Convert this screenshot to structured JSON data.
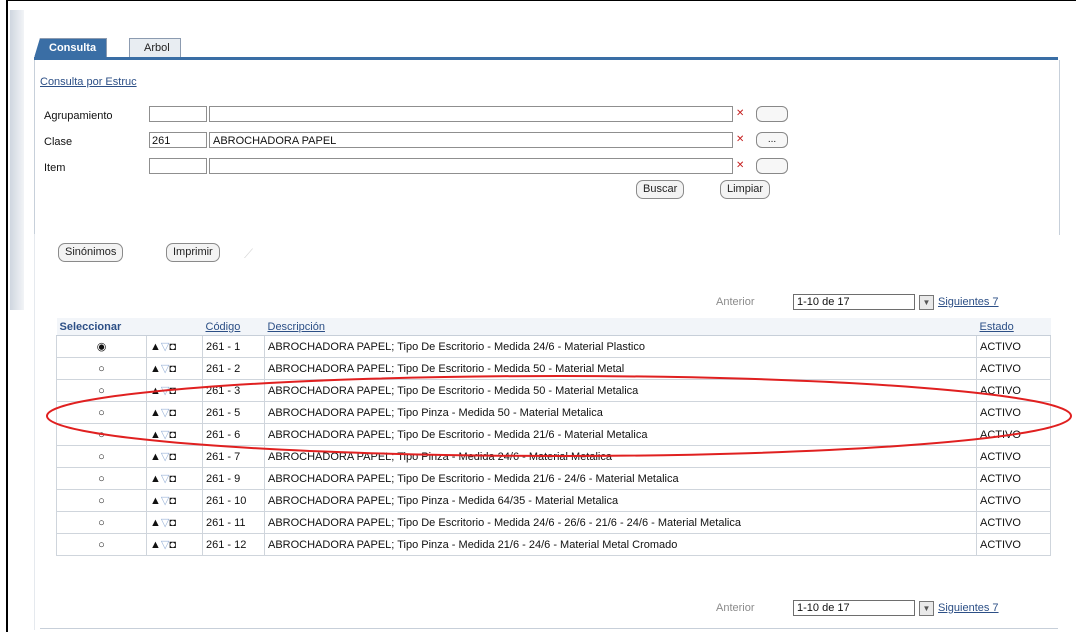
{
  "tabs": [
    {
      "label": "Consulta"
    },
    {
      "label": "Arbol"
    }
  ],
  "section_link": "Consulta por Estruc",
  "fields": [
    {
      "label": "Agrupamiento",
      "code": "",
      "desc": ""
    },
    {
      "label": "Clase",
      "code": "261",
      "desc": "ABROCHADORA PAPEL"
    },
    {
      "label": "Item",
      "code": "",
      "desc": ""
    }
  ],
  "lov_label": "...",
  "buttons": {
    "buscar": "Buscar",
    "limpiar": "Limpiar",
    "sinonimos": "Sinónimos",
    "imprimir": "Imprimir"
  },
  "pager": {
    "prev": "Anterior",
    "range": "1-10 de 17",
    "next": "Siguientes 7"
  },
  "table": {
    "headers": {
      "select": "Seleccionar",
      "code": "Código",
      "desc": "Descripción",
      "state": "Estado"
    },
    "rows": [
      {
        "selected": true,
        "code": "261 - 1",
        "desc": "ABROCHADORA PAPEL; Tipo De Escritorio - Medida 24/6 - Material Plastico",
        "state": "ACTIVO"
      },
      {
        "selected": false,
        "code": "261 - 2",
        "desc": "ABROCHADORA PAPEL; Tipo De Escritorio - Medida 50 - Material Metal",
        "state": "ACTIVO"
      },
      {
        "selected": false,
        "code": "261 - 3",
        "desc": "ABROCHADORA PAPEL; Tipo De Escritorio - Medida 50 - Material Metalica",
        "state": "ACTIVO"
      },
      {
        "selected": false,
        "code": "261 - 5",
        "desc": "ABROCHADORA PAPEL; Tipo Pinza - Medida 50 - Material Metalica",
        "state": "ACTIVO"
      },
      {
        "selected": false,
        "code": "261 - 6",
        "desc": "ABROCHADORA PAPEL; Tipo De Escritorio - Medida 21/6 - Material Metalica",
        "state": "ACTIVO"
      },
      {
        "selected": false,
        "code": "261 - 7",
        "desc": "ABROCHADORA PAPEL; Tipo Pinza - Medida 24/6 - Material Metalica",
        "state": "ACTIVO"
      },
      {
        "selected": false,
        "code": "261 - 9",
        "desc": "ABROCHADORA PAPEL; Tipo De Escritorio - Medida 21/6 - 24/6 - Material Metalica",
        "state": "ACTIVO"
      },
      {
        "selected": false,
        "code": "261 - 10",
        "desc": "ABROCHADORA PAPEL; Tipo Pinza - Medida 64/35 - Material Metalica",
        "state": "ACTIVO"
      },
      {
        "selected": false,
        "code": "261 - 11",
        "desc": "ABROCHADORA PAPEL; Tipo De Escritorio - Medida 24/6 - 26/6 - 21/6 - 24/6 - Material Metalica",
        "state": "ACTIVO"
      },
      {
        "selected": false,
        "code": "261 - 12",
        "desc": "ABROCHADORA PAPEL; Tipo Pinza - Medida 21/6 - 24/6 - Material Metal Cromado",
        "state": "ACTIVO"
      }
    ]
  },
  "colors": {
    "accent": "#3a6ea5",
    "link": "#2c4f86",
    "annotation": "#e02020"
  }
}
